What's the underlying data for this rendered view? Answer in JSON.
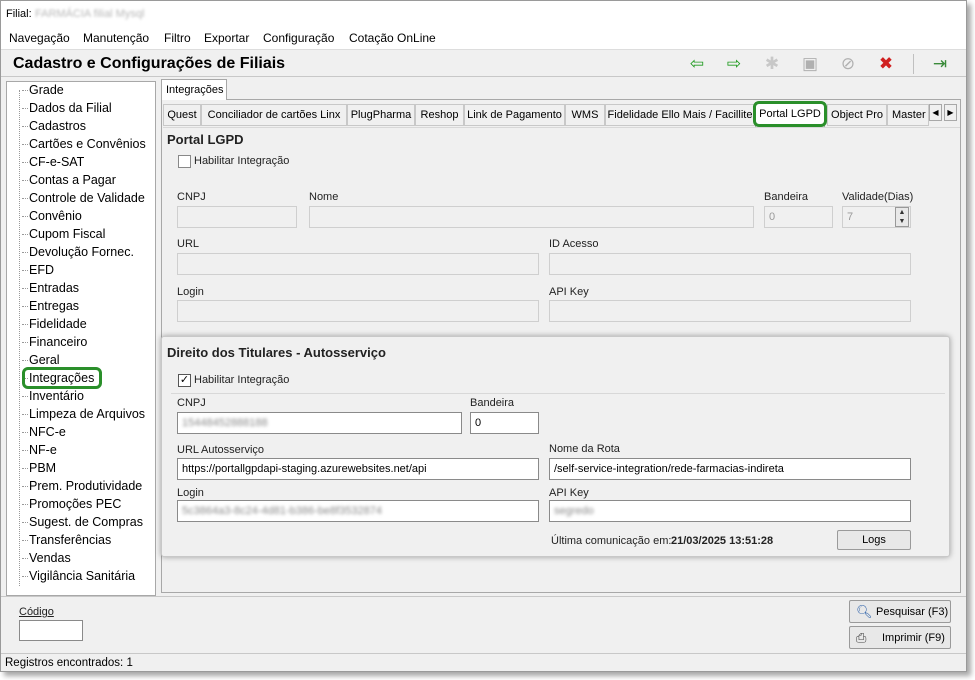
{
  "titlebar": {
    "label": "Filial:",
    "value": "FARMÁCIA filial Mysql"
  },
  "menu": [
    "Navegação",
    "Manutenção",
    "Filtro",
    "Exportar",
    "Configuração",
    "Cotação OnLine"
  ],
  "header": {
    "title": "Cadastro e Configurações de Filiais"
  },
  "toolbar": [
    "arrow-left-icon",
    "arrow-right-icon",
    "new-icon",
    "save-icon",
    "cancel-icon",
    "delete-icon",
    "exit-icon"
  ],
  "sidebar": {
    "items": [
      "Grade",
      "Dados da Filial",
      "Cadastros",
      "Cartões e Convênios",
      "CF-e-SAT",
      "Contas a Pagar",
      "Controle de Validade",
      "Convênio",
      "Cupom Fiscal",
      "Devolução Fornec.",
      "EFD",
      "Entradas",
      "Entregas",
      "Fidelidade",
      "Financeiro",
      "Geral",
      "Integrações",
      "Inventário",
      "Limpeza de Arquivos",
      "NFC-e",
      "NF-e",
      "PBM",
      "Prem. Produtividade",
      "Promoções PEC",
      "Sugest. de Compras",
      "Transferências",
      "Vendas",
      "Vigilância Sanitária"
    ],
    "selected": "Integrações"
  },
  "outer_tab": "Integrações",
  "tabs": [
    "Quest",
    "Conciliador de cartões Linx",
    "PlugPharma",
    "Reshop",
    "Link de Pagamento",
    "WMS",
    "Fidelidade Ello Mais / Facillite",
    "Portal LGPD",
    "Object Pro",
    "Master"
  ],
  "active_tab": "Portal LGPD",
  "portal": {
    "title": "Portal LGPD",
    "enable_label": "Habilitar Integração",
    "enabled": false,
    "cnpj_label": "CNPJ",
    "cnpj": "",
    "nome_label": "Nome",
    "nome": "",
    "bandeira_label": "Bandeira",
    "bandeira": "0",
    "validade_label": "Validade(Dias)",
    "validade": "7",
    "url_label": "URL",
    "url": "",
    "id_label": "ID Acesso",
    "id": "",
    "login_label": "Login",
    "login": "",
    "apikey_label": "API Key",
    "apikey": ""
  },
  "autoservico": {
    "title": "Direito dos Titulares - Autosserviço",
    "enable_label": "Habilitar Integração",
    "enabled": true,
    "cnpj_label": "CNPJ",
    "cnpj": "15448452888188",
    "bandeira_label": "Bandeira",
    "bandeira": "0",
    "url_label": "URL Autosserviço",
    "url": "https://portallgpdapi-staging.azurewebsites.net/api",
    "rota_label": "Nome da Rota",
    "rota": "/self-service-integration/rede-farmacias-indireta",
    "login_label": "Login",
    "login": "5c3864a3-8c24-4d81-b386-be8f3532874",
    "apikey_label": "API Key",
    "apikey": "segredo",
    "last_comm_label": "Última comunicação em:",
    "last_comm": "21/03/2025 13:51:28",
    "logs_button": "Logs"
  },
  "bottom": {
    "codigo_label": "Código",
    "codigo": "",
    "pesquisar": "Pesquisar (F3)",
    "imprimir": "Imprimir (F9)"
  },
  "status": "Registros encontrados: 1",
  "colors": {
    "highlight": "#2a8f2a",
    "arrow": "#1f9a1f",
    "delete": "#d02020"
  }
}
